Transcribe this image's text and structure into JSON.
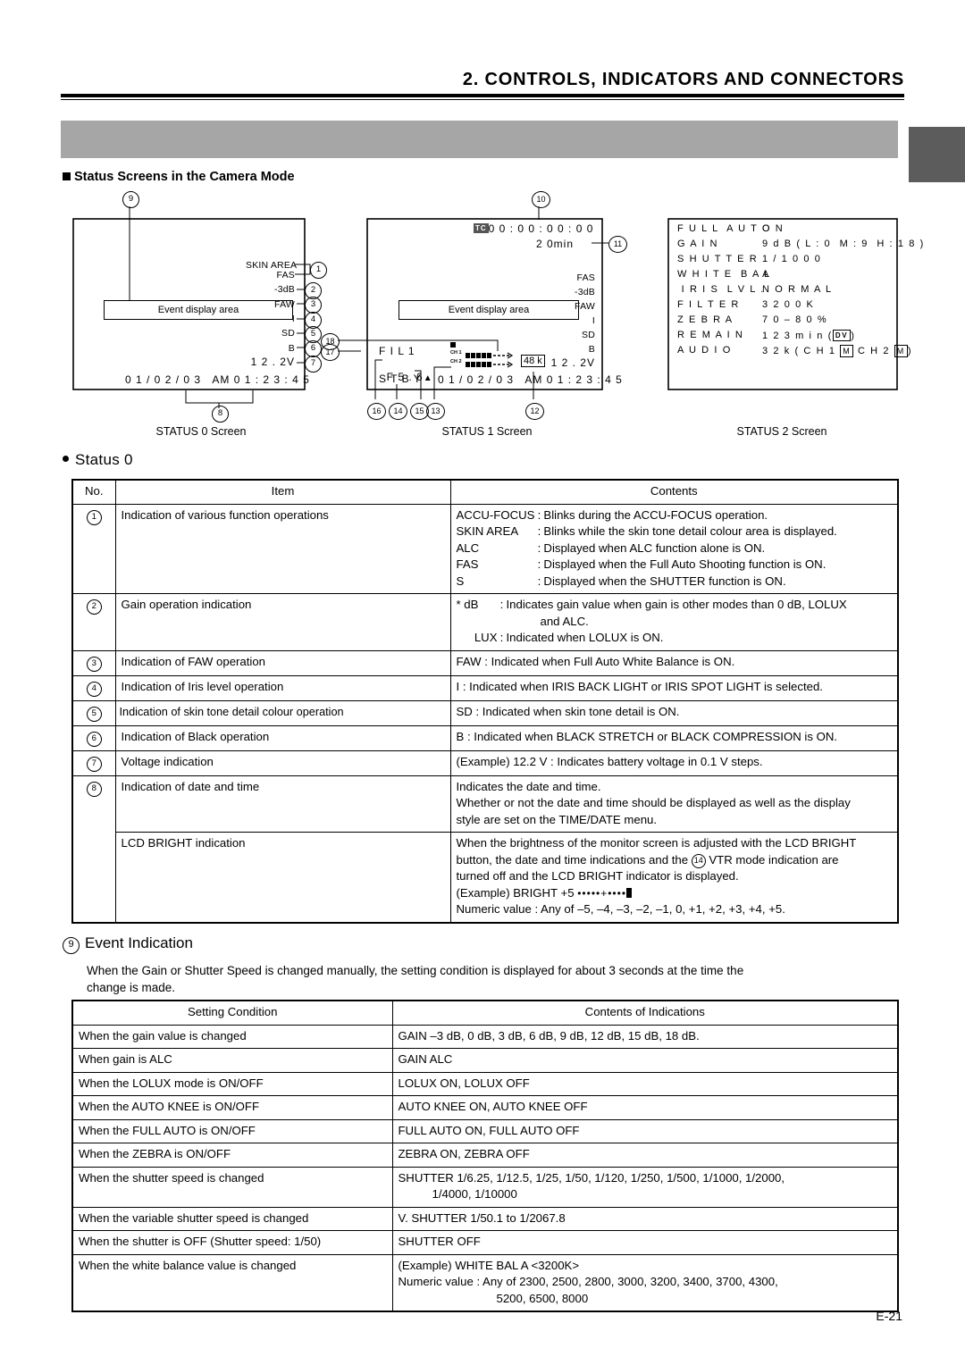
{
  "header": {
    "title": "2. CONTROLS, INDICATORS AND CONNECTORS",
    "section_label": "Status Screens in the Camera Mode"
  },
  "page_number": "E-21",
  "diagram": {
    "captions": {
      "status0": "STATUS 0 Screen",
      "status1": "STATUS 1 Screen",
      "status2": "STATUS 2 Screen"
    },
    "event_display_box_0": "Event display   area",
    "event_display_box_1": "Event display area",
    "status0": {
      "indicators": [
        "SKIN AREA",
        "FAS",
        "-3dB",
        "FAW",
        "I",
        "SD",
        "B",
        "1 2 . 2V"
      ],
      "datetime": "0 1 / 0 2 / 0 3   AM 0 1 : 2 3 : 4 5"
    },
    "status1": {
      "tc_badge": "TC",
      "timecode": "0 0 : 0 0 : 0 0 : 0 0",
      "remain": "2 0min",
      "indicators": [
        "FAS",
        "-3dB",
        "FAW",
        "I",
        "SD",
        "B",
        "1 2 . 2V"
      ],
      "filter": "F I L 1",
      "iris": "F 5 . 6",
      "mode": "S T B Y",
      "ch1_label": "CH 1",
      "ch2_label": "CH 2",
      "sampling": "48 k",
      "datetime": "0 1 / 0 2 / 0 3   AM 0 1 : 2 3 : 4 5"
    },
    "status2": {
      "rows": [
        {
          "item": "F U L L  A U T O",
          "value": "O N"
        },
        {
          "item": "G A I N",
          "value": "9 d B ( L : 0  M : 9  H : 1 8 )"
        },
        {
          "item": "S H U T T E R",
          "value": "1 / 1 0 0 0"
        },
        {
          "item": "W H I T E  B A L",
          "value": "A"
        },
        {
          "item": " I R I S  L V L .",
          "value": "N O R M A L"
        },
        {
          "item": "F I L T E R",
          "value": "3 2 0 0 K"
        },
        {
          "item": "Z E B R A",
          "value": "7 0 – 8 0 %"
        },
        {
          "item": "R E M A I N",
          "value_prefix": "1 2 3 m i n (",
          "value_badge": "DV",
          "value_suffix": ")"
        },
        {
          "item": "A U D I O",
          "value_prefix": "3 2 k ( C H 1 ",
          "badge1": "M",
          "mid": " C H 2 ",
          "badge2": "M",
          "value_suffix": ")"
        }
      ]
    },
    "callouts": [
      "1",
      "2",
      "3",
      "4",
      "5",
      "6",
      "7",
      "8",
      "9",
      "10",
      "11",
      "12",
      "13",
      "14",
      "15",
      "16",
      "17",
      "18"
    ]
  },
  "status0_section": {
    "heading": "Status 0",
    "heading_bullet": "●",
    "columns": [
      "No.",
      "Item",
      "Contents"
    ],
    "rows": [
      {
        "no": "1",
        "item": "Indication of various function operations",
        "contents_defs": [
          {
            "term": "ACCU-FOCUS",
            "desc": "Blinks during the ACCU-FOCUS operation."
          },
          {
            "term": "SKIN AREA",
            "desc": "Blinks while the skin tone detail colour area is displayed."
          },
          {
            "term": "ALC",
            "desc": "Displayed when ALC function alone is ON."
          },
          {
            "term": "FAS",
            "desc": "Displayed when the Full Auto Shooting function is ON."
          },
          {
            "term": "S",
            "desc": "Displayed when the SHUTTER function is ON."
          }
        ]
      },
      {
        "no": "2",
        "item": "Gain operation indication",
        "contents_defs": [
          {
            "term": "* dB",
            "desc": "Indicates gain value when gain is other modes than 0 dB, LOLUX"
          },
          {
            "term": "",
            "desc": "and ALC.",
            "indent": 1
          },
          {
            "term": "LUX",
            "desc": "Indicated when LOLUX is ON."
          }
        ]
      },
      {
        "no": "3",
        "item": "Indication of FAW operation",
        "contents": "FAW : Indicated when Full Auto White Balance is ON."
      },
      {
        "no": "4",
        "item": "Indication of Iris level operation",
        "contents": "I : Indicated when IRIS BACK LIGHT or IRIS SPOT LIGHT is selected."
      },
      {
        "no": "5",
        "item": "Indication of skin tone detail colour operation",
        "contents": "SD : Indicated when skin tone detail is ON."
      },
      {
        "no": "6",
        "item": "Indication of Black operation",
        "contents": "B : Indicated when BLACK STRETCH or BLACK COMPRESSION is ON."
      },
      {
        "no": "7",
        "item": "Voltage indication",
        "contents": "(Example) 12.2 V : Indicates battery voltage in 0.1 V steps."
      },
      {
        "no": "8",
        "item": "Indication of date and time",
        "contents_lines": [
          "Indicates the date and time.",
          "Whether or not the date and time should be displayed as well as the display",
          "style are set on the TIME/DATE menu."
        ]
      },
      {
        "no": "",
        "item": "LCD BRIGHT indication",
        "contents_lines": [
          "When the brightness of the monitor screen is adjusted with the LCD BRIGHT",
          "button, the date and time indications and the ① VTR mode indication are",
          "turned off and the LCD BRIGHT indicator is displayed."
        ],
        "contents_example": "(Example) BRIGHT +5",
        "contents_bright_dots": "•••••+••••",
        "contents_numeric": "Numeric value : Any of –5, –4, –3, –2, –1, 0, +1, +2, +3, +4, +5.",
        "vtr_note_number": "14"
      }
    ]
  },
  "event_section": {
    "number": "9",
    "heading": "Event Indication",
    "paragraph_lines": [
      "When the Gain or Shutter Speed is changed manually, the setting condition is displayed for about 3 seconds at the time the",
      "change is made."
    ],
    "columns": [
      "Setting Condition",
      "Contents of Indications"
    ],
    "rows": [
      {
        "condition": "When the gain value is changed",
        "indication": "GAIN –3 dB, 0 dB, 3 dB, 6 dB, 9 dB, 12 dB, 15 dB, 18 dB."
      },
      {
        "condition": "When gain is ALC",
        "indication": "GAIN ALC"
      },
      {
        "condition": "When the LOLUX mode is ON/OFF",
        "indication": "LOLUX ON, LOLUX OFF"
      },
      {
        "condition": "When the AUTO KNEE is ON/OFF",
        "indication": "AUTO KNEE ON, AUTO KNEE OFF"
      },
      {
        "condition": "When the FULL AUTO is ON/OFF",
        "indication": "FULL AUTO ON, FULL AUTO OFF"
      },
      {
        "condition": "When the ZEBRA is ON/OFF",
        "indication": "ZEBRA ON, ZEBRA OFF"
      },
      {
        "condition": "When the shutter speed is changed",
        "indication_lines": [
          "SHUTTER 1/6.25, 1/12.5, 1/25, 1/50, 1/120, 1/250, 1/500, 1/1000, 1/2000,",
          "1/4000, 1/10000"
        ],
        "indent_line2": 1
      },
      {
        "condition": "When the variable shutter speed is changed",
        "indication": "V. SHUTTER 1/50.1 to 1/2067.8"
      },
      {
        "condition": "When the shutter is OFF (Shutter speed: 1/50)",
        "indication": "SHUTTER OFF"
      },
      {
        "condition": "When the white balance value is changed",
        "indication_lines": [
          "(Example) WHITE BAL A <3200K>",
          "Numeric value : Any of 2300, 2500, 2800, 3000, 3200, 3400, 3700, 4300,",
          "5200, 6500, 8000"
        ],
        "indent_line3": 2
      }
    ]
  },
  "colors": {
    "band": "#a6a6a6",
    "tab": "#5c5c5c",
    "rule": "#000000",
    "tc_badge_bg": "#555555"
  }
}
